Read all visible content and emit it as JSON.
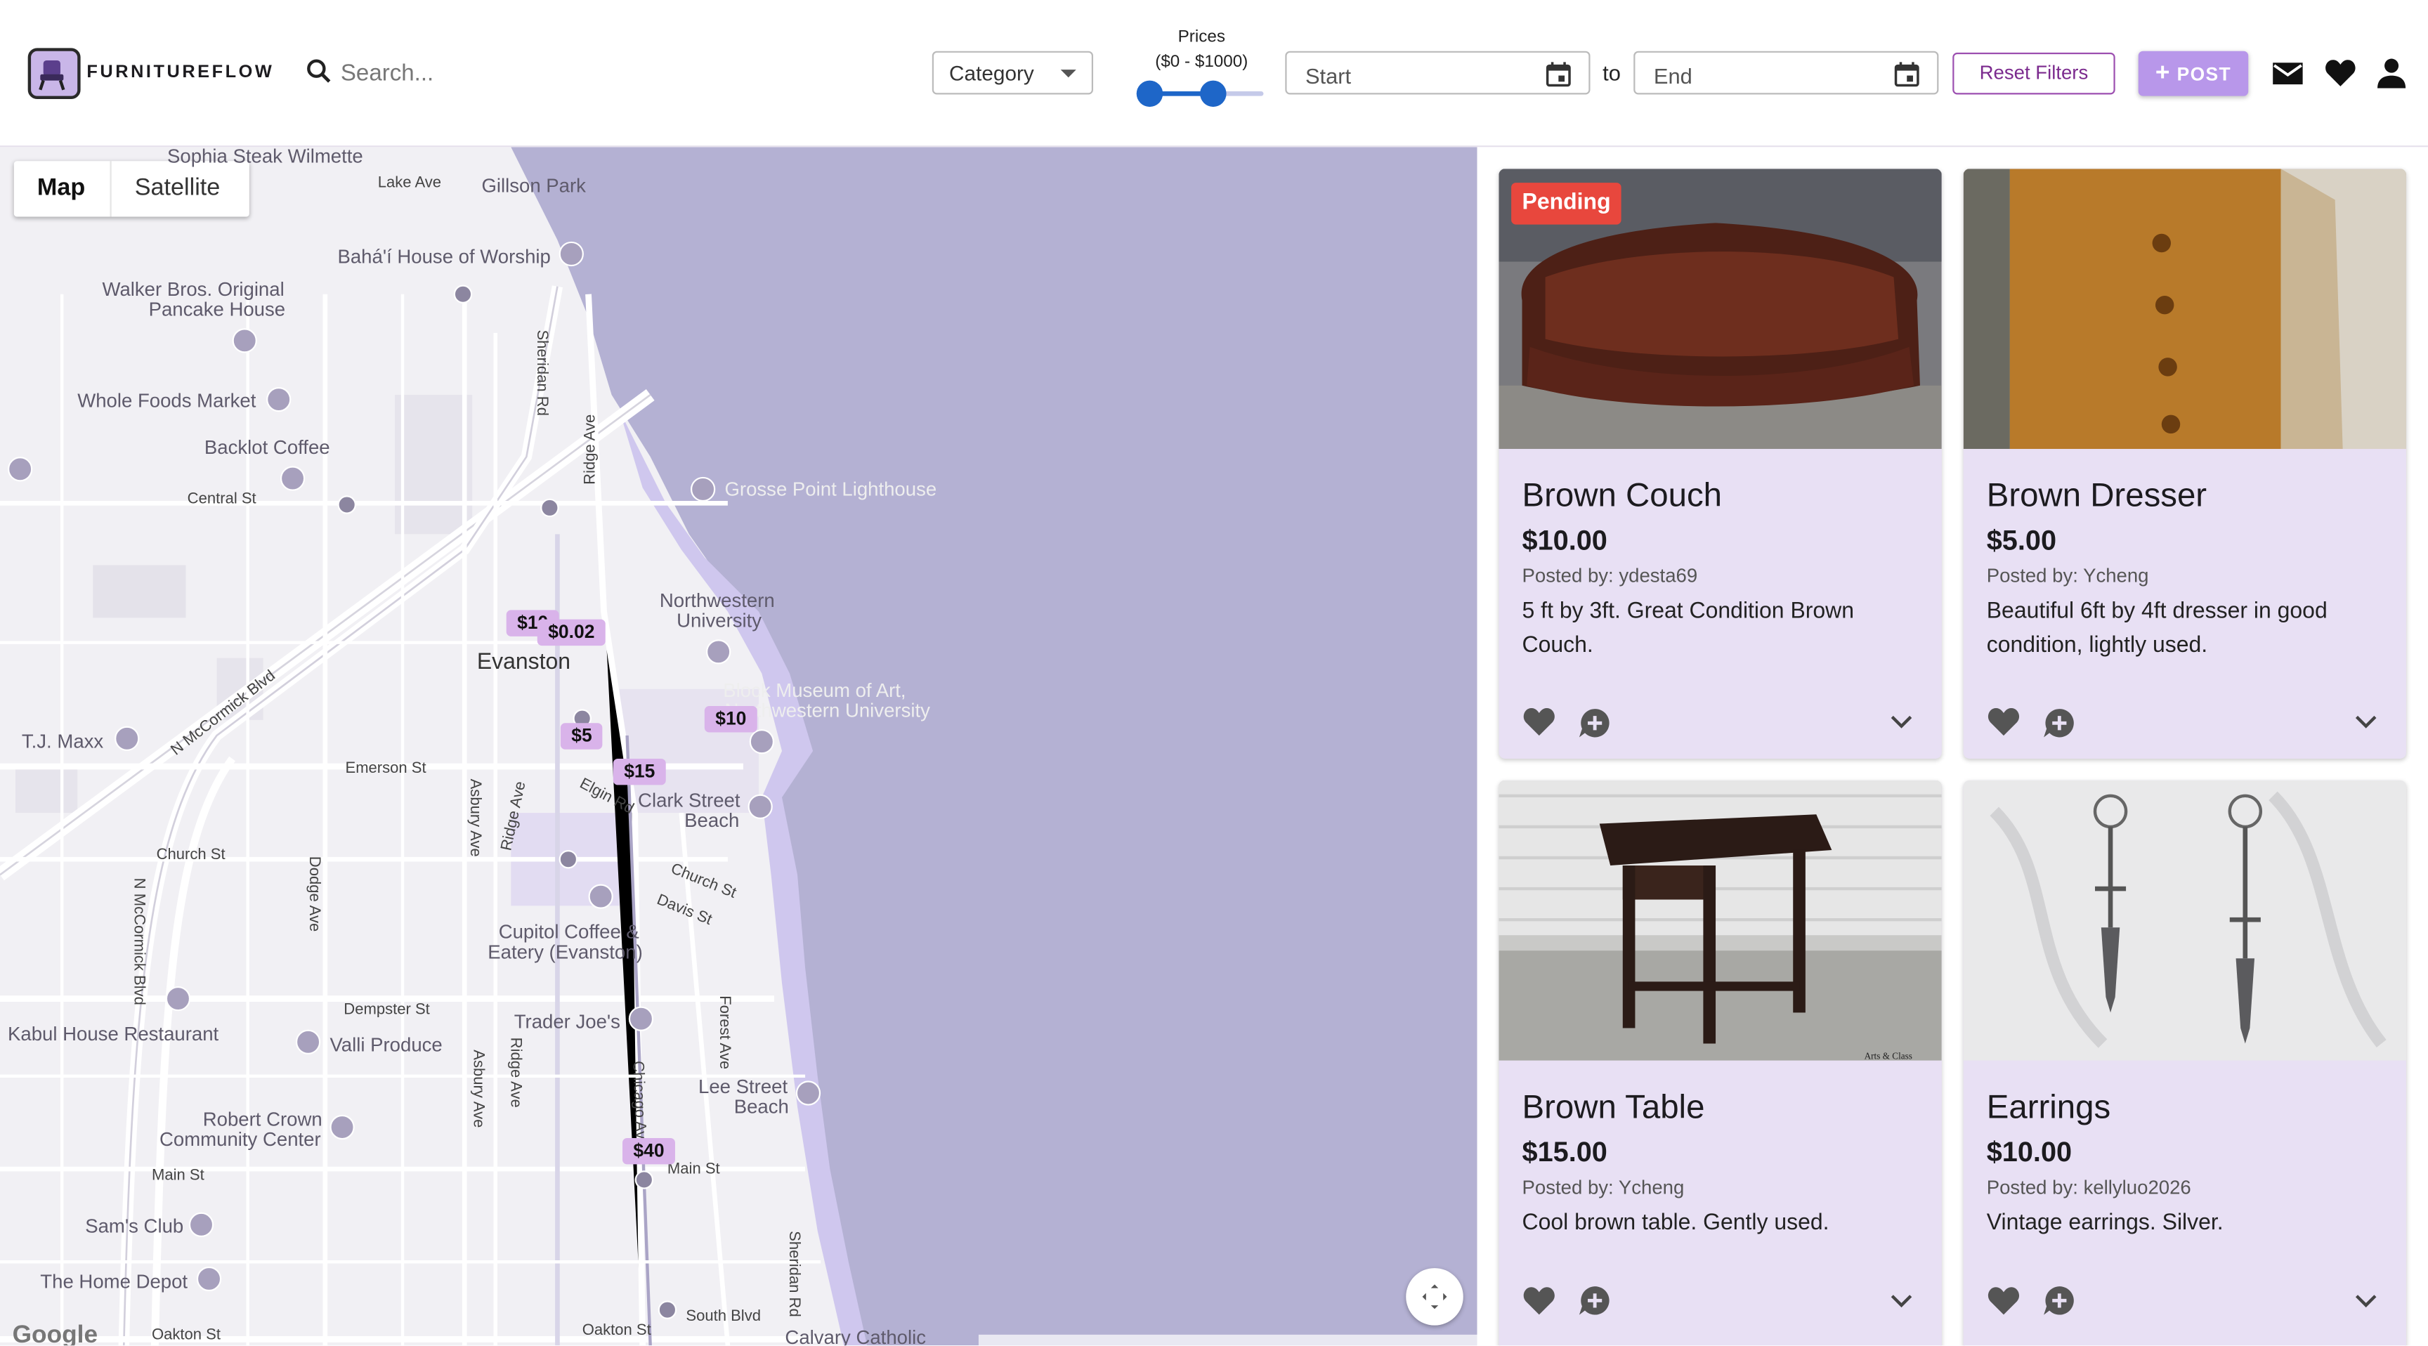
{
  "header": {
    "brand": "FURNITUREFLOW",
    "search_placeholder": "Search...",
    "category_label": "Category",
    "prices_label": "Prices",
    "prices_range": "($0 - $1000)",
    "price_min_fraction": 0,
    "price_max_fraction": 0.5,
    "start_placeholder": "Start",
    "to_label": "to",
    "end_placeholder": "End",
    "reset_label": "Reset Filters",
    "post_label": "POST",
    "icons": [
      "search-icon",
      "calendar-icon",
      "mail-icon",
      "heart-icon",
      "account-icon"
    ],
    "accent": "#b897ea"
  },
  "map": {
    "tab_map": "Map",
    "tab_satellite": "Satellite",
    "labels": {
      "sophia": "Sophia Steak Wilmette",
      "lake_ave": "Lake Ave",
      "gillson": "Gillson Park",
      "bahai": "Bahá'í House of Worship",
      "walker1": "Walker Bros. Original",
      "walker2": "Pancake House",
      "sheridan": "Sheridan Rd",
      "whole_foods": "Whole Foods Market",
      "backlot": "Backlot Coffee",
      "central": "Central St",
      "ridge": "Ridge Ave",
      "grosse": "Grosse Point Lighthouse",
      "nw1": "Northwestern",
      "nw2": "University",
      "evanston": "Evanston",
      "block1": "Block Museum of Art,",
      "block2": "Northwestern University",
      "mccormick": "N McCormick Blvd",
      "tjmaxx": "T.J. Maxx",
      "emerson": "Emerson St",
      "elgin": "Elgin Rd",
      "clark1": "Clark Street",
      "clark2": "Beach",
      "dodge": "Dodge Ave",
      "asbury": "Asbury Ave",
      "ridge2": "Ridge Ave",
      "church": "Church St",
      "church2": "Church St",
      "davis": "Davis St",
      "cupitol1": "Cupitol Coffee &",
      "cupitol2": "Eatery (Evanston)",
      "n_mccormick": "N McCormick Blvd",
      "dempster": "Dempster St",
      "kabul": "Kabul House Restaurant",
      "valli": "Valli Produce",
      "traderjoes": "Trader Joe's",
      "forest": "Forest Ave",
      "asbury2": "Asbury Ave",
      "ridge3": "Ridge Ave",
      "chicago": "Chicago Ave",
      "lee1": "Lee Street",
      "lee2": "Beach",
      "robert1": "Robert Crown",
      "robert2": "Community Center",
      "main": "Main St",
      "main2": "Main St",
      "sams": "Sam's Club",
      "homedepot": "The Home Depot",
      "sheridan2": "Sheridan Rd",
      "oakton": "Oakton St",
      "oakton2": "Oakton St",
      "southblvd": "South Blvd",
      "calvary": "Calvary Catholic",
      "google": "Google"
    },
    "price_tags": [
      {
        "label": "$10"
      },
      {
        "label": "$0.02"
      },
      {
        "label": "$5"
      },
      {
        "label": "$10"
      },
      {
        "label": "$15"
      },
      {
        "label": "$40"
      }
    ]
  },
  "listings": [
    {
      "title": "Brown Couch",
      "price": "$10.00",
      "posted_by": "Posted by: ydesta69",
      "description": "5 ft by 3ft. Great Condition Brown Couch.",
      "badge": "Pending",
      "badge_color": "#e8473d"
    },
    {
      "title": "Brown Dresser",
      "price": "$5.00",
      "posted_by": "Posted by: Ycheng",
      "description": "Beautiful 6ft by 4ft dresser in good condition, lightly used."
    },
    {
      "title": "Brown Table",
      "price": "$15.00",
      "posted_by": "Posted by: Ycheng",
      "description": "Cool brown table. Gently used.",
      "photo_caption": "Arts & Class"
    },
    {
      "title": "Earrings",
      "price": "$10.00",
      "posted_by": "Posted by: kellyluo2026",
      "description": "Vintage earrings. Silver."
    }
  ]
}
